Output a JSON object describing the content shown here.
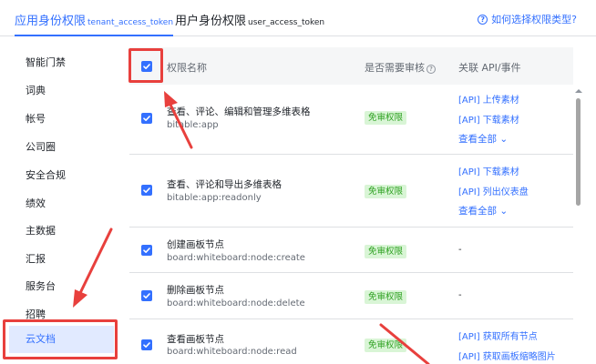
{
  "tabs": {
    "app": {
      "label": "应用身份权限",
      "sub": "tenant_access_token"
    },
    "user": {
      "label": "用户身份权限",
      "sub": "user_access_token"
    },
    "help": "如何选择权限类型?"
  },
  "sidebar": {
    "items": [
      "智能门禁",
      "词典",
      "帐号",
      "公司圈",
      "安全合规",
      "绩效",
      "主数据",
      "汇报",
      "服务台",
      "招聘",
      "云文档"
    ],
    "selected": "云文档"
  },
  "table": {
    "headers": {
      "name": "权限名称",
      "audit": "是否需要审核",
      "api": "关联 API/事件"
    },
    "rows": [
      {
        "name": "查看、评论、编辑和管理多维表格",
        "code": "bitable:app",
        "audit": "免审权限",
        "apis": [
          "[API] 上传素材",
          "[API] 下载素材"
        ],
        "view_all": "查看全部"
      },
      {
        "name": "查看、评论和导出多维表格",
        "code": "bitable:app:readonly",
        "audit": "免审权限",
        "apis": [
          "[API] 下载素材",
          "[API] 列出仪表盘"
        ],
        "view_all": "查看全部"
      },
      {
        "name": "创建画板节点",
        "code": "board:whiteboard:node:create",
        "audit": "免审权限",
        "apis": [],
        "dash": "-"
      },
      {
        "name": "删除画板节点",
        "code": "board:whiteboard:node:delete",
        "audit": "免审权限",
        "apis": [],
        "dash": "-"
      },
      {
        "name": "查看画板节点",
        "code": "board:whiteboard:node:read",
        "audit": "免审权限",
        "apis": [
          "[API] 获取所有节点",
          "[API] 获取画板缩略图片"
        ]
      }
    ]
  },
  "colors": {
    "accent": "#3370ff",
    "annotation": "#e8403d",
    "badge_bg": "#d9f5d6",
    "badge_text": "#2ea121"
  }
}
